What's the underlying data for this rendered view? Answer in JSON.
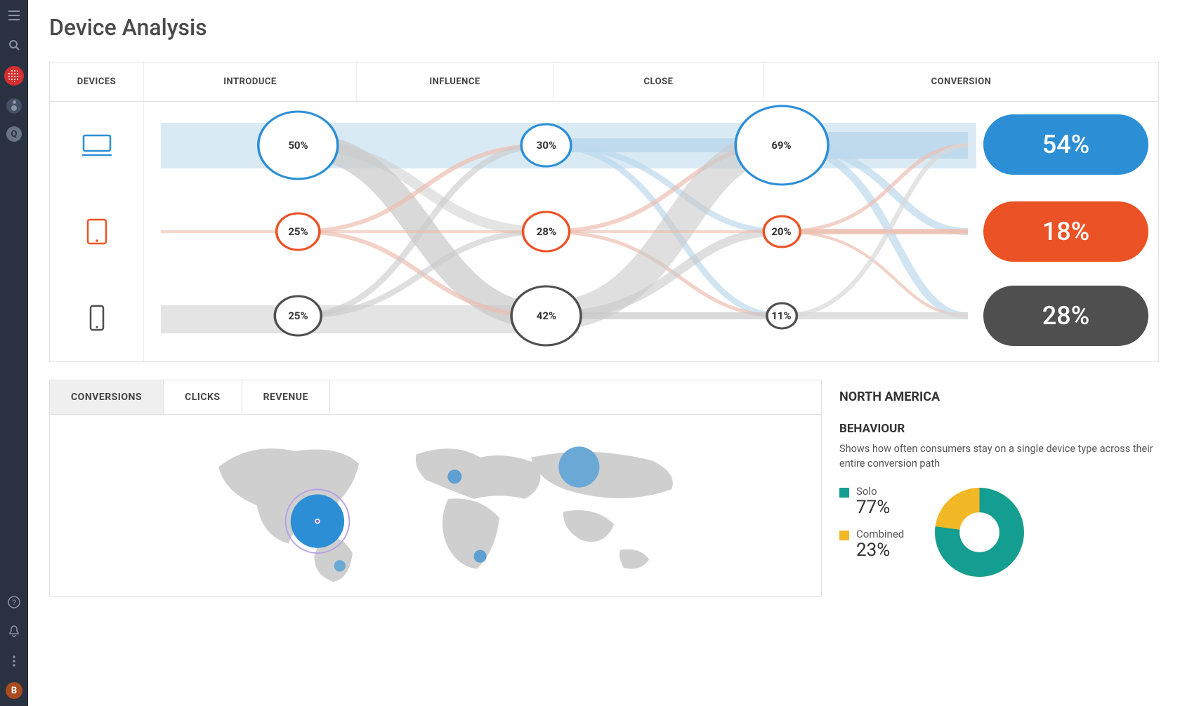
{
  "page_title": "Device Analysis",
  "colors": {
    "desktop": "#2c8fd6",
    "tablet": "#eb5225",
    "mobile": "#4f4f4f",
    "flow_light": "#dcdcdc",
    "flow_blue_light": "#bcd8ec",
    "teal": "#149e91",
    "yellow": "#f2b825"
  },
  "sidebar": {
    "top_icons": [
      "menu-icon",
      "search-icon",
      "brand-icon",
      "selector-icon",
      "q-icon"
    ],
    "bottom_icons": [
      "help-icon",
      "bell-icon",
      "dots-icon",
      "avatar"
    ],
    "avatar_letter": "B",
    "q_letter": "Q"
  },
  "device_table": {
    "headers": {
      "devices": "DEVICES",
      "introduce": "INTRODUCE",
      "influence": "INFLUENCE",
      "close": "CLOSE",
      "conversion": "CONVERSION"
    },
    "rows": [
      {
        "device": "desktop",
        "introduce": "50%",
        "influence": "30%",
        "close": "69%",
        "conversion": "54%"
      },
      {
        "device": "tablet",
        "introduce": "25%",
        "influence": "28%",
        "close": "20%",
        "conversion": "18%"
      },
      {
        "device": "mobile",
        "introduce": "25%",
        "influence": "42%",
        "close": "11%",
        "conversion": "28%"
      }
    ]
  },
  "tabs": [
    {
      "label": "CONVERSIONS",
      "active": true
    },
    {
      "label": "CLICKS",
      "active": false
    },
    {
      "label": "REVENUE",
      "active": false
    }
  ],
  "region_panel": {
    "region": "NORTH AMERICA",
    "behaviour_title": "BEHAVIOUR",
    "behaviour_desc": "Shows how often consumers stay on a single device type across their entire conversion path",
    "legend": [
      {
        "name": "Solo",
        "value": "77%",
        "color": "#149e91"
      },
      {
        "name": "Combined",
        "value": "23%",
        "color": "#f2b825"
      }
    ]
  },
  "chart_data": [
    {
      "type": "sankey",
      "title": "Device path from introduce to close to conversion",
      "stages": [
        "introduce",
        "influence",
        "close",
        "conversion"
      ],
      "series": [
        {
          "name": "desktop",
          "values": [
            50,
            30,
            69,
            54
          ]
        },
        {
          "name": "tablet",
          "values": [
            25,
            28,
            20,
            18
          ]
        },
        {
          "name": "mobile",
          "values": [
            25,
            42,
            11,
            28
          ]
        }
      ],
      "unit": "%"
    },
    {
      "type": "map",
      "title": "Conversions by region (bubble map)",
      "series": [
        {
          "name": "North America",
          "relative_size": 100,
          "selected": true
        },
        {
          "name": "South America",
          "relative_size": 12
        },
        {
          "name": "Europe",
          "relative_size": 15
        },
        {
          "name": "Africa",
          "relative_size": 10
        },
        {
          "name": "Russia/Asia",
          "relative_size": 55
        }
      ]
    },
    {
      "type": "pie",
      "title": "Behaviour – solo vs combined device paths",
      "categories": [
        "Solo",
        "Combined"
      ],
      "values": [
        77,
        23
      ],
      "unit": "%"
    }
  ]
}
